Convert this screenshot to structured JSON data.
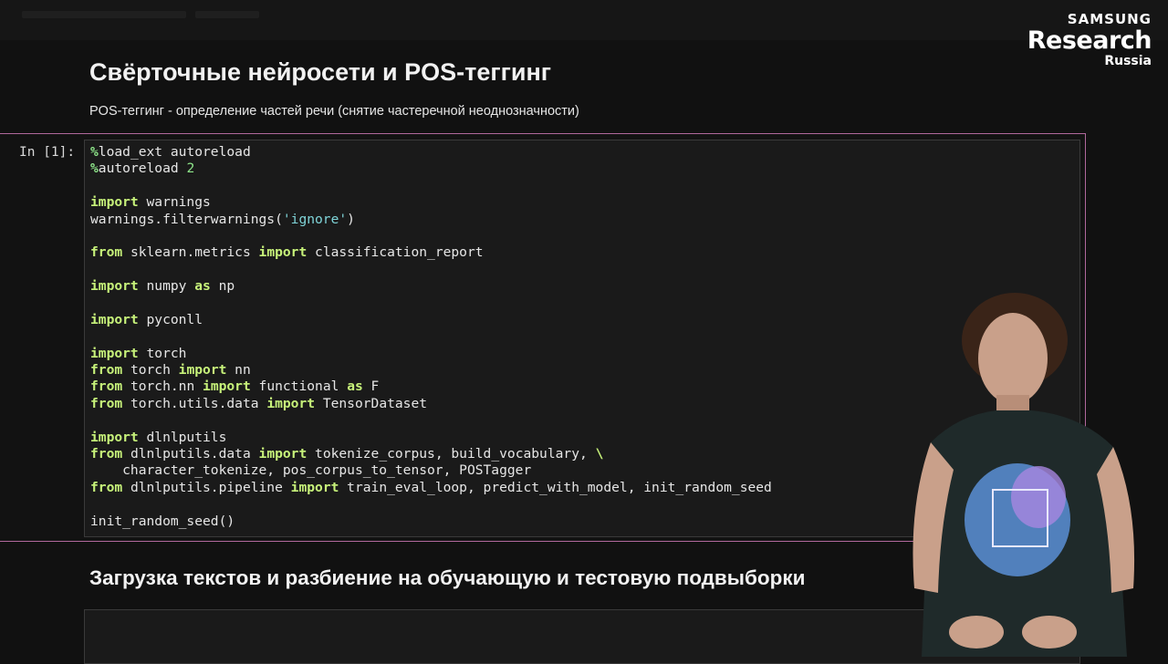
{
  "brand": {
    "line1": "SAMSUNG",
    "line2": "Research",
    "line3": "Russia"
  },
  "notebook": {
    "title": "Свёрточные нейросети и POS-теггинг",
    "subtitle": "POS-теггинг - определение частей речи (снятие частеречной неоднозначности)",
    "cell": {
      "prompt": "In [1]:",
      "code_lines": [
        "%load_ext autoreload",
        "%autoreload 2",
        "",
        "import warnings",
        "warnings.filterwarnings('ignore')",
        "",
        "from sklearn.metrics import classification_report",
        "",
        "import numpy as np",
        "",
        "import pyconll",
        "",
        "import torch",
        "from torch import nn",
        "from torch.nn import functional as F",
        "from torch.utils.data import TensorDataset",
        "",
        "import dlnlputils",
        "from dlnlputils.data import tokenize_corpus, build_vocabulary, \\",
        "    character_tokenize, pos_corpus_to_tensor, POSTagger",
        "from dlnlputils.pipeline import train_eval_loop, predict_with_model, init_random_seed",
        "",
        "init_random_seed()"
      ]
    },
    "section_heading": "Загрузка текстов и разбиение на обучающую и тестовую подвыборки"
  },
  "colors": {
    "background": "#111111",
    "cell_border": "#b0689c",
    "keyword": "#c7f27a",
    "string": "#7fd4d8",
    "magic": "#8ee68a"
  }
}
